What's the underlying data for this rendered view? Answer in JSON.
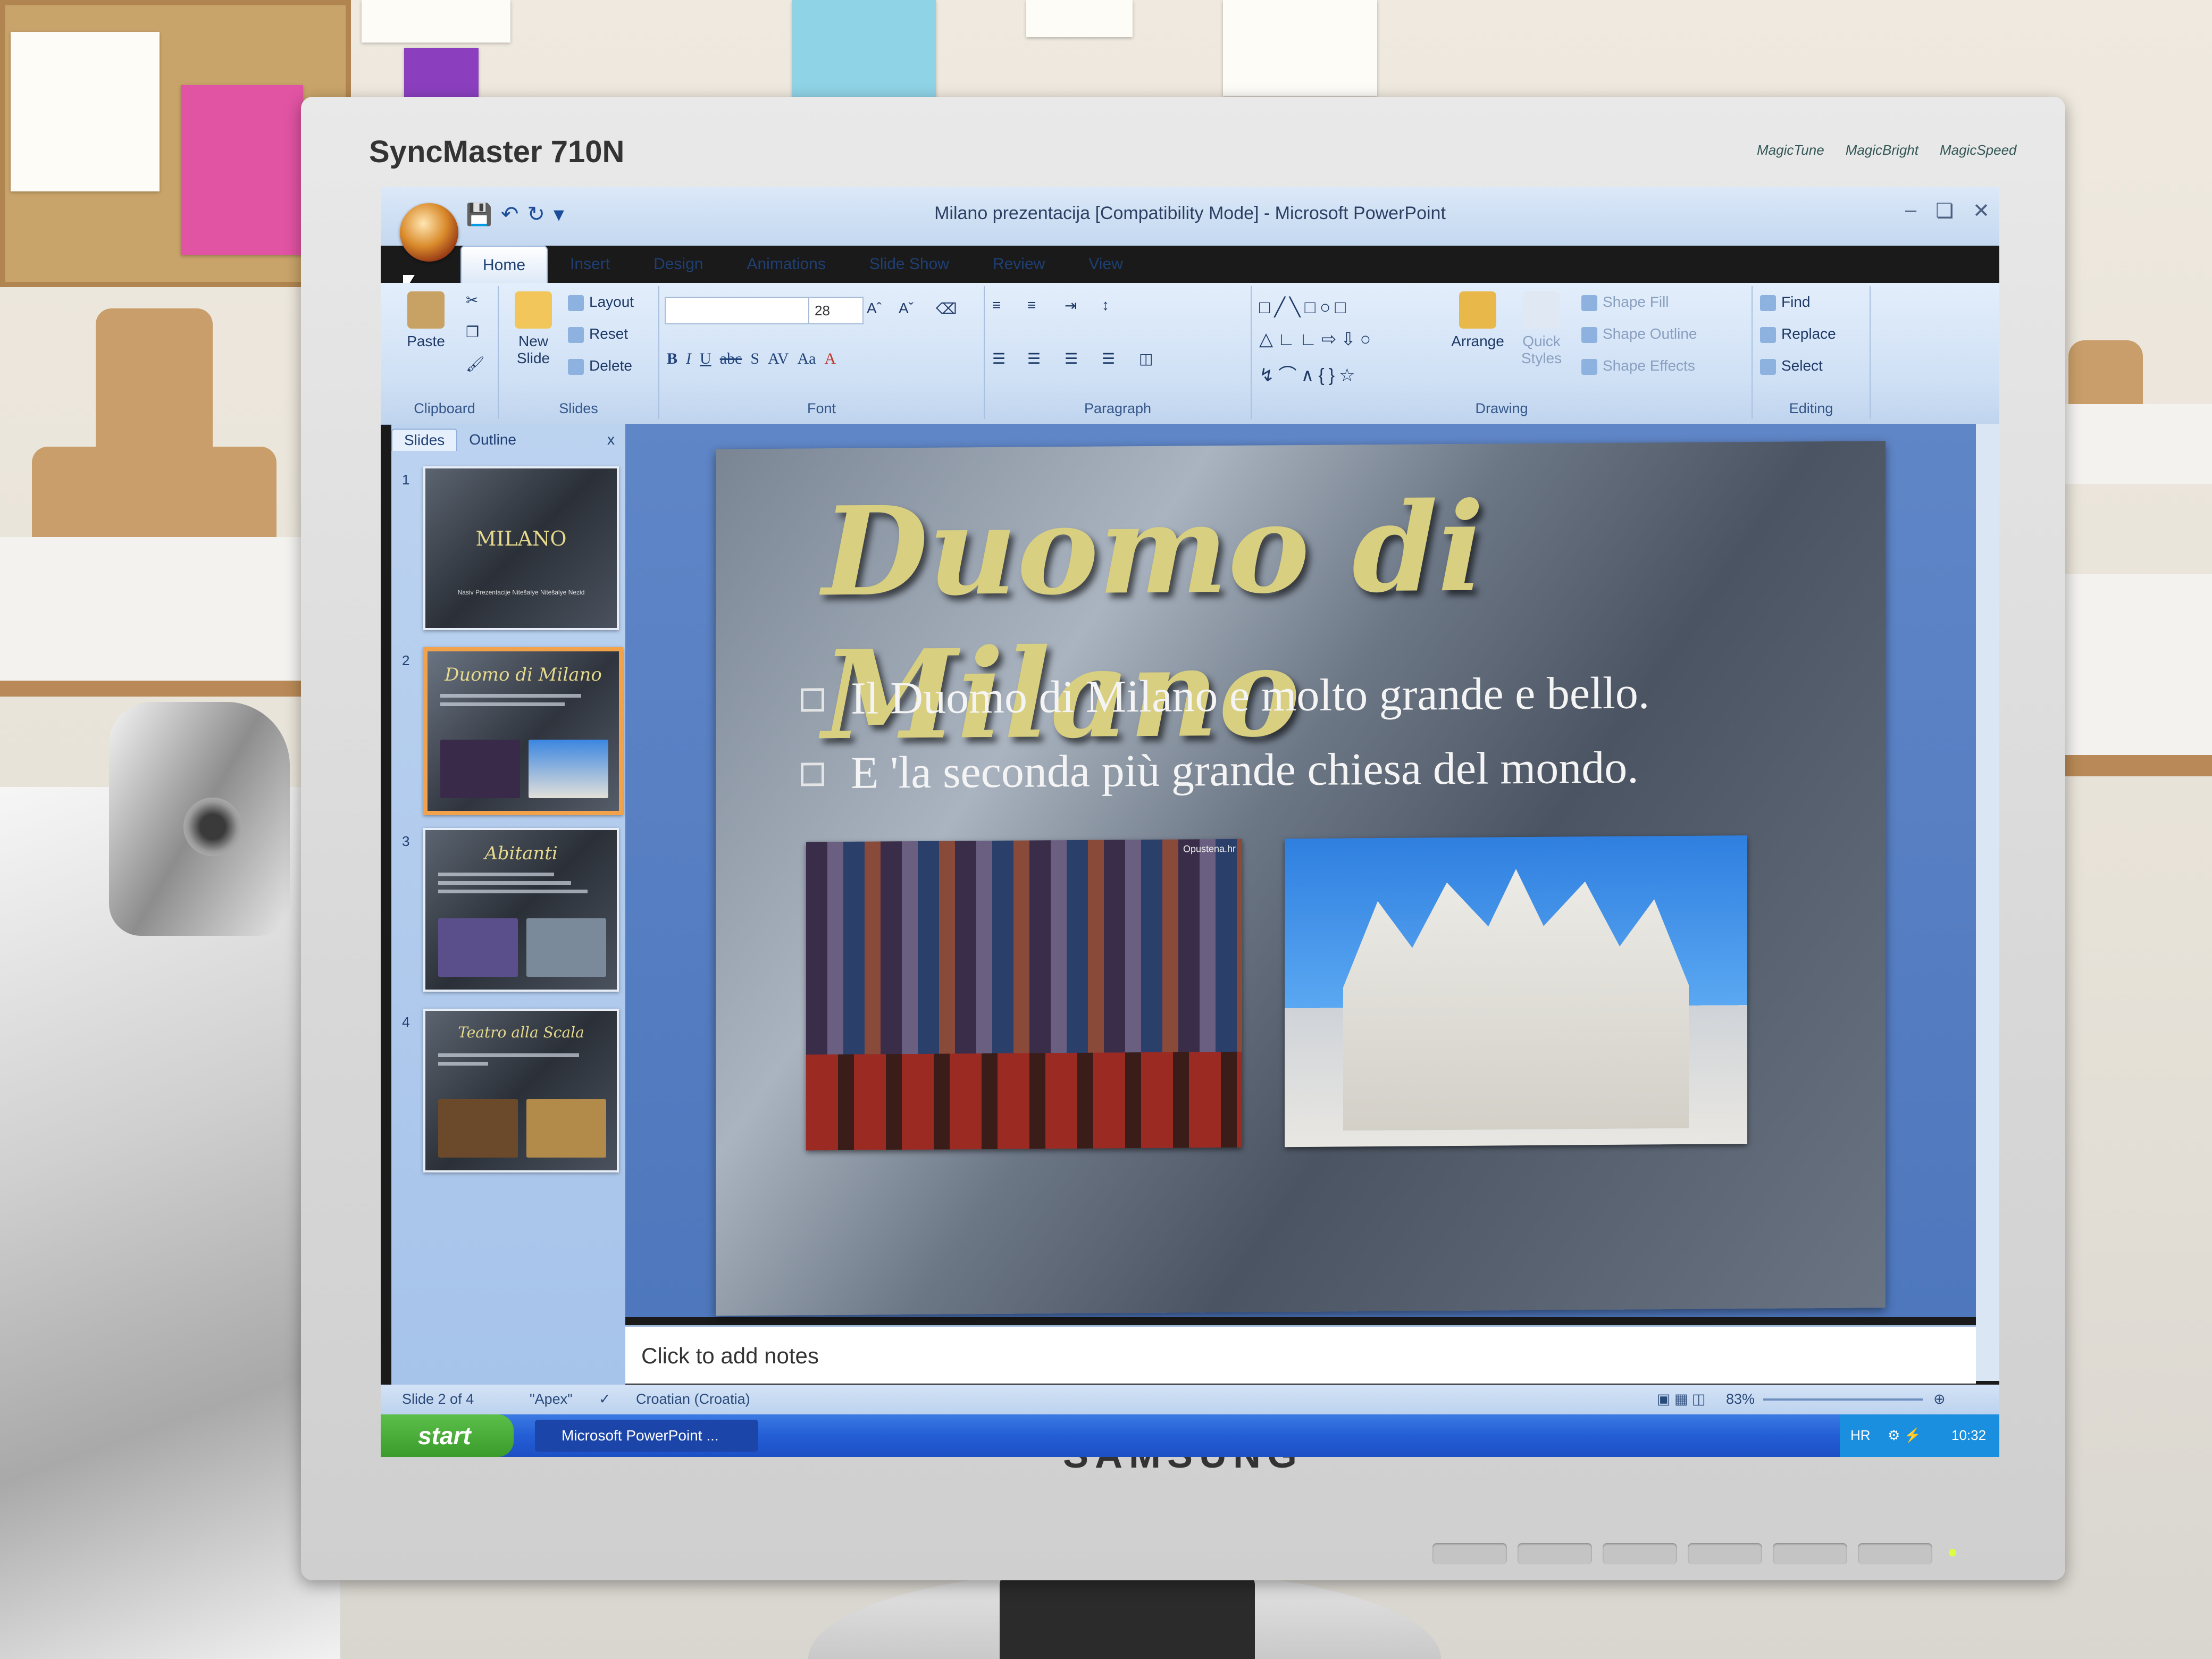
{
  "monitor": {
    "model": "SyncMaster 710N",
    "brand": "SAMSUNG",
    "logos": [
      "MagicTune",
      "MagicBright",
      "MagicSpeed"
    ]
  },
  "app": {
    "window_title": "Milano prezentacija [Compatibility Mode] - Microsoft PowerPoint",
    "tabs": [
      "Home",
      "Insert",
      "Design",
      "Animations",
      "Slide Show",
      "Review",
      "View"
    ],
    "active_tab": "Home"
  },
  "ribbon": {
    "clipboard": {
      "label": "Clipboard",
      "paste": "Paste"
    },
    "slides": {
      "label": "Slides",
      "new_slide": "New Slide",
      "layout": "Layout",
      "reset": "Reset",
      "delete": "Delete"
    },
    "font": {
      "label": "Font",
      "font_name": "",
      "font_size": "28",
      "bold": "B",
      "italic": "I",
      "underline": "U",
      "strike": "abc",
      "shadow": "S",
      "spacing": "AV",
      "case": "Aa"
    },
    "paragraph": {
      "label": "Paragraph"
    },
    "drawing": {
      "label": "Drawing",
      "arrange": "Arrange",
      "quick_styles": "Quick Styles",
      "shape_fill": "Shape Fill",
      "shape_outline": "Shape Outline",
      "shape_effects": "Shape Effects"
    },
    "editing": {
      "label": "Editing",
      "find": "Find",
      "replace": "Replace",
      "select": "Select"
    }
  },
  "left_pane": {
    "tabs": [
      "Slides",
      "Outline"
    ],
    "close": "x",
    "thumbnails": [
      {
        "num": "1",
        "title": "MILANO",
        "subtitle": "Nasiv Prezentacije Nitešalye Nitešalye Nezid"
      },
      {
        "num": "2",
        "title": "Duomo di Milano",
        "selected": true
      },
      {
        "num": "3",
        "title": "Abitanti"
      },
      {
        "num": "4",
        "title": "Teatro alla Scala"
      }
    ]
  },
  "slide": {
    "title": "Duomo di Milano",
    "bullets": [
      "Il Duomo di Milano e molto grande e bello.",
      "E 'la seconda più grande chiesa del mondo."
    ],
    "image_tag": "Opustena.hr"
  },
  "notes": {
    "placeholder": "Click to add notes"
  },
  "status": {
    "slide_info": "Slide 2 of 4",
    "theme": "\"Apex\"",
    "language": "Croatian (Croatia)",
    "zoom": "83%"
  },
  "taskbar": {
    "start": "start",
    "item": "Microsoft PowerPoint ...",
    "lang": "HR",
    "clock": "10:32"
  }
}
